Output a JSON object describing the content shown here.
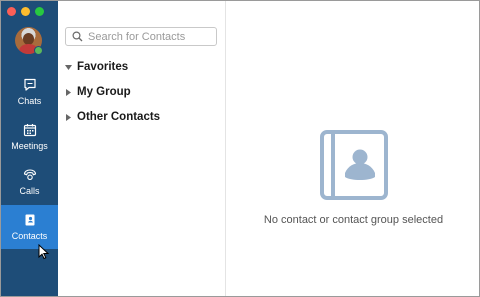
{
  "nav": {
    "items": [
      {
        "label": "Chats",
        "icon": "chat-icon"
      },
      {
        "label": "Meetings",
        "icon": "calendar-icon"
      },
      {
        "label": "Calls",
        "icon": "phone-icon"
      },
      {
        "label": "Contacts",
        "icon": "contact-card-icon",
        "active": true
      }
    ],
    "presence_status_color": "#5cb85c",
    "active_color": "#2b7fd2",
    "rail_color": "#1e4d78"
  },
  "search": {
    "placeholder": "Search for Contacts",
    "value": ""
  },
  "groups": [
    {
      "label": "Favorites",
      "expanded": true
    },
    {
      "label": "My Group",
      "expanded": false
    },
    {
      "label": "Other Contacts",
      "expanded": false
    }
  ],
  "main": {
    "empty_message": "No contact or contact group selected",
    "empty_icon": "contact-book-icon"
  }
}
